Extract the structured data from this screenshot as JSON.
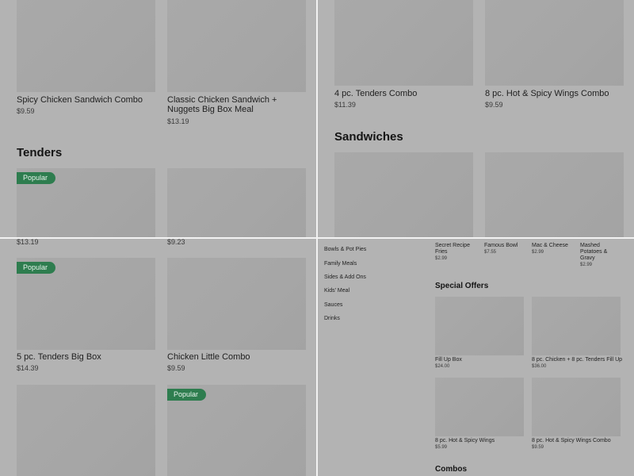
{
  "q1": {
    "items": [
      {
        "name": "Spicy Chicken Sandwich Combo",
        "price": "$9.59"
      },
      {
        "name": "Classic Chicken Sandwich + Nuggets Big Box Meal",
        "price": "$13.19"
      }
    ],
    "section_title": "Tenders",
    "badge": "Popular",
    "bottom_prices": [
      "$13.19",
      "$9.23"
    ]
  },
  "q2": {
    "items": [
      {
        "name": "4 pc. Tenders Combo",
        "price": "$11.39"
      },
      {
        "name": "8 pc. Hot & Spicy Wings Combo",
        "price": "$9.59"
      }
    ],
    "section_title": "Sandwiches"
  },
  "q3": {
    "badge": "Popular",
    "items": [
      {
        "name": "5 pc. Tenders Big Box",
        "price": "$14.39"
      },
      {
        "name": "Chicken Little Combo",
        "price": "$9.59"
      }
    ]
  },
  "q4": {
    "nav": [
      "Bowls & Pot Pies",
      "Family Meals",
      "Sides & Add Ons",
      "Kids' Meal",
      "Sauces",
      "Drinks"
    ],
    "top_items": [
      {
        "name": "Secret Recipe Fries",
        "price": "$2.99"
      },
      {
        "name": "Famous Bowl",
        "price": "$7.55"
      },
      {
        "name": "Mac & Cheese",
        "price": "$2.99"
      },
      {
        "name": "Mashed Potatoes & Gravy",
        "price": "$2.99"
      }
    ],
    "special_offers_title": "Special Offers",
    "special_offers": [
      {
        "name": "Fill Up Box",
        "price": "$24.00"
      },
      {
        "name": "8 pc. Chicken + 8 pc. Tenders Fill Up",
        "price": "$36.00"
      },
      {
        "name": "8 pc. Hot & Spicy Wings",
        "price": "$5.99"
      },
      {
        "name": "8 pc. Hot & Spicy Wings Combo",
        "price": "$9.59"
      }
    ],
    "combos_title": "Combos"
  }
}
